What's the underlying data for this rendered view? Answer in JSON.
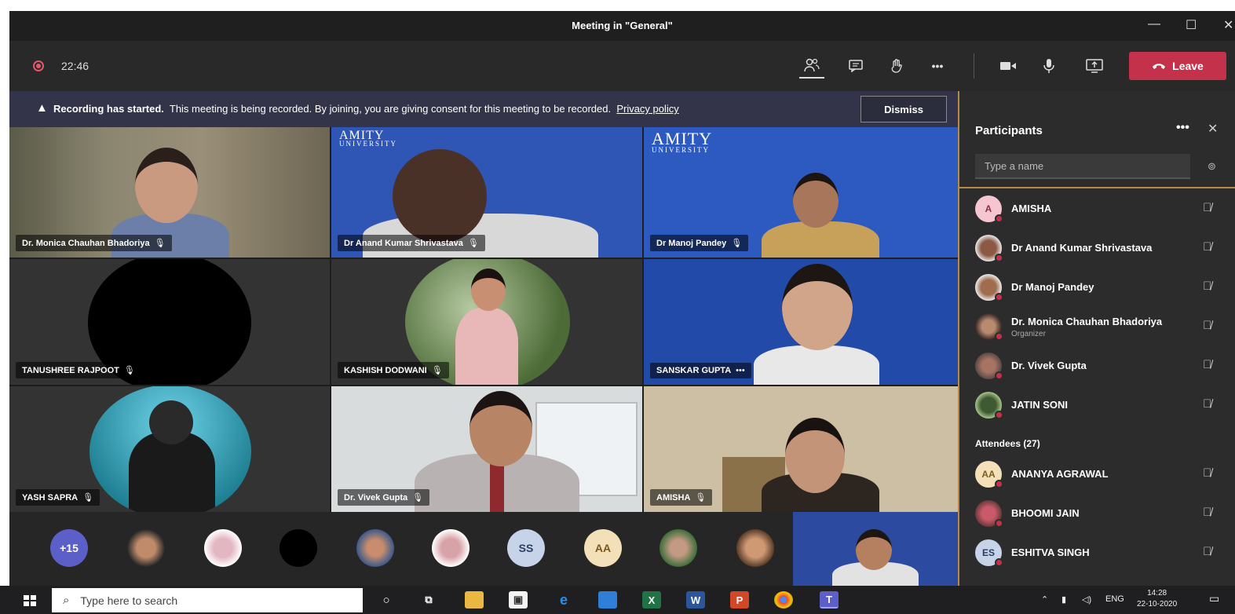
{
  "window": {
    "title": "Meeting in \"General\"",
    "minimize": "—",
    "maximize": "☐",
    "close": "✕"
  },
  "toolbar": {
    "timer": "22:46",
    "leave_label": "Leave",
    "more_glyph": "•••"
  },
  "banner": {
    "title": "Recording has started.",
    "message": "This meeting is being recorded. By joining, you are giving consent for this meeting to be recorded.",
    "link": "Privacy policy",
    "dismiss_label": "Dismiss"
  },
  "tiles": [
    {
      "name": "Dr. Monica Chauhan Bhadoriya"
    },
    {
      "name": "Dr Anand Kumar Shrivastava"
    },
    {
      "name": "Dr Manoj Pandey"
    },
    {
      "name": "TANUSHREE RAJPOOT"
    },
    {
      "name": "KASHISH DODWANI"
    },
    {
      "name": "SANSKAR GUPTA"
    },
    {
      "name": "YASH SAPRA"
    },
    {
      "name": "Dr. Vivek Gupta"
    },
    {
      "name": "AMISHA"
    }
  ],
  "logos": {
    "amity_left": "AMITY",
    "amity_left_sub": "UNIVERSITY",
    "amity_right": "AMITY",
    "amity_right_sub": "UNIVERSITY"
  },
  "strip": {
    "overflow": "+15",
    "initials_ss": "SS",
    "initials_aa": "AA"
  },
  "participants": {
    "title": "Participants",
    "more_glyph": "•••",
    "close_glyph": "✕",
    "search_placeholder": "Type a name",
    "attendees_label": "Attendees (27)",
    "presenters": [
      {
        "initials": "A",
        "name": "AMISHA",
        "role": ""
      },
      {
        "initials": "",
        "name": "Dr Anand Kumar Shrivastava",
        "role": ""
      },
      {
        "initials": "",
        "name": "Dr Manoj Pandey",
        "role": ""
      },
      {
        "initials": "",
        "name": "Dr. Monica Chauhan Bhadoriya",
        "role": "Organizer"
      },
      {
        "initials": "",
        "name": "Dr. Vivek Gupta",
        "role": ""
      },
      {
        "initials": "",
        "name": "JATIN SONI",
        "role": ""
      }
    ],
    "attendees": [
      {
        "initials": "AA",
        "name": "ANANYA AGRAWAL"
      },
      {
        "initials": "",
        "name": "BHOOMI JAIN"
      },
      {
        "initials": "ES",
        "name": "ESHITVA SINGH"
      }
    ]
  },
  "taskbar": {
    "search_placeholder": "Type here to search",
    "lang": "ENG",
    "time": "14:28",
    "date": "22-10-2020"
  }
}
